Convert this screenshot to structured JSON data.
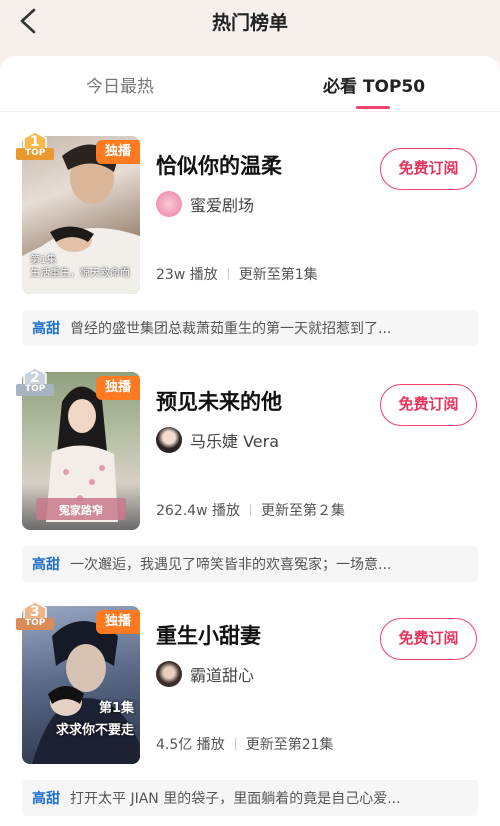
{
  "header": {
    "title": "热门榜单",
    "back_icon": "chevron-left-icon"
  },
  "tabs": [
    {
      "label": "今日最热",
      "active": false
    },
    {
      "label": "必看 TOP50",
      "active": true
    }
  ],
  "colors": {
    "accent": "#f0446c",
    "tag_blue": "#1f6fd1",
    "exclusive_orange": "#ff7a20"
  },
  "items": [
    {
      "rank": "1",
      "rank_tag": "TOP",
      "exclusive": "独播",
      "title": "恰似你的温柔",
      "author": "蜜爱剧场",
      "views": "23w 播放",
      "update": "更新至第1集",
      "subscribe": "免费订阅",
      "tag": "高甜",
      "desc": "曾经的盛世集团总裁萧茹重生的第一天就招惹到了...",
      "poster_text": "第1集\n生活重生，惊天救命而"
    },
    {
      "rank": "2",
      "rank_tag": "TOP",
      "exclusive": "独播",
      "title": "预见未来的他",
      "author": "马乐婕 Vera",
      "views": "262.4w 播放",
      "update": "更新至第２集",
      "subscribe": "免费订阅",
      "tag": "高甜",
      "desc": "一次邂逅，我遇见了啼笑皆非的欢喜冤家；一场意...",
      "poster_text": "冤家路窄"
    },
    {
      "rank": "3",
      "rank_tag": "TOP",
      "exclusive": "独播",
      "title": "重生小甜妻",
      "author": "霸道甜心",
      "views": "4.5亿 播放",
      "update": "更新至第21集",
      "subscribe": "免费订阅",
      "tag": "高甜",
      "desc": "打开太平 JIAN 里的袋子，里面躺着的竟是自己心爱...",
      "poster_text": "第1集\n求求你不要走"
    }
  ]
}
